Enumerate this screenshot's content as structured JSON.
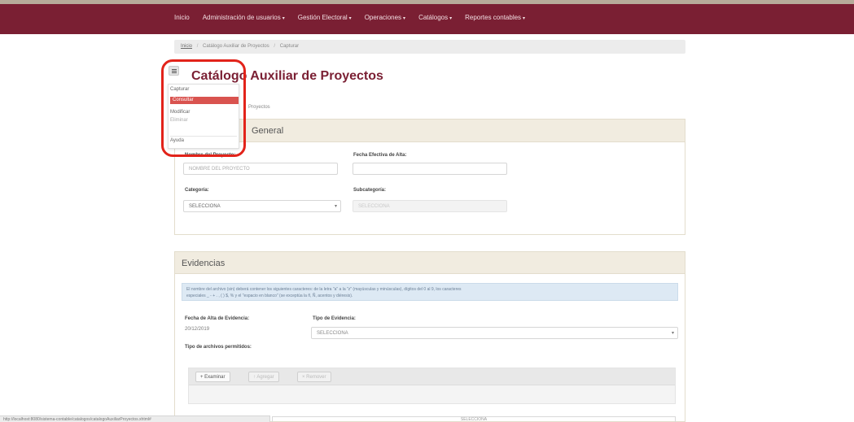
{
  "nav": {
    "items": [
      {
        "label": "Inicio",
        "has_caret": false
      },
      {
        "label": "Administración de usuarios",
        "has_caret": true
      },
      {
        "label": "Gestión Electoral",
        "has_caret": true
      },
      {
        "label": "Operaciones",
        "has_caret": true
      },
      {
        "label": "Catálogos",
        "has_caret": true
      },
      {
        "label": "Reportes contables",
        "has_caret": true
      }
    ]
  },
  "breadcrumb": {
    "home": "Inicio",
    "catalog": "Catálogo Auxiliar de Proyectos",
    "current": "Capturar"
  },
  "page": {
    "title": "Catálogo Auxiliar de Proyectos",
    "subtext": "Proyectos"
  },
  "menu": {
    "capturar": "Capturar",
    "consultar": "Consultar",
    "modificar": "Modificar",
    "eliminar": "Eliminar",
    "ayuda": "Ayuda"
  },
  "general": {
    "heading": "General",
    "nombre_label": "Nombre del Proyecto:",
    "nombre_placeholder": "NOMBRE DEL PROYECTO",
    "fecha_label": "Fecha Efectiva de Alta:",
    "fecha_value": "",
    "categoria_label": "Categoría:",
    "categoria_value": "SELECCIONA",
    "subcategoria_label": "Subcategoría:",
    "subcategoria_value": "SELECCIONA"
  },
  "evidencias": {
    "heading": "Evidencias",
    "info_line1": "El nombre del archivo (sin) deberá contener los siguientes caracteres: de la letra \"a\" a la \"z\" (mayúsculas y minúsculas), dígitos del 0 al 9, los caracteres",
    "info_line2": "especiales _ - + . , ( ) $, % y el \"espacio en blanco\" (se exceptúa la ñ, Ñ, acentos y diéresis).",
    "fecha_label": "Fecha de Alta de Evidencia:",
    "fecha_value": "20/12/2019",
    "tipo_label": "Tipo de Evidencia:",
    "tipo_value": "SELECCIONA",
    "permitidos_label": "Tipo de archivos permitidos:",
    "btn_examinar": "+ Examinar",
    "btn_agregar": "↑ Agregar",
    "btn_remover": "× Remover"
  },
  "status": {
    "url": "http://localhost:8080/sistema-contable/catalogos/catalogoAuxiliarProyectos.xhtml#",
    "bottom_field": "SELECCIONA"
  }
}
